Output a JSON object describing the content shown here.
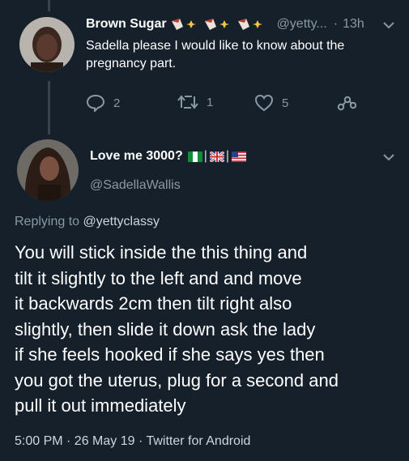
{
  "tweet1": {
    "display_name": "Brown Sugar",
    "handle": "@yetty...",
    "separator": "·",
    "time": "13h",
    "text_line1": "Sadella please I would like to know about the",
    "text_line2": "pregnancy part.",
    "replies": "2",
    "retweets": "1",
    "likes": "5"
  },
  "tweet2": {
    "display_name": "Love me 3000?",
    "handle": "@SadellaWallis",
    "replying_prefix": "Replying to ",
    "replying_handle": "@yettyclassy",
    "lines": [
      "You will stick inside the this thing and",
      "tilt it slightly to the left and and move",
      "it backwards 2cm then tilt right also",
      "slightly, then slide it down ask the lady",
      "if she feels hooked if she says yes then",
      "you got the uterus, plug for a second and",
      "pull it out immediately"
    ],
    "footer": "5:00 PM · 26 May 19 · Twitter for Android"
  },
  "colors": {
    "background": "#15202b",
    "text": "#ffffff",
    "secondary": "#8899a6",
    "thread_line": "#38444d"
  },
  "icons": [
    "reply-icon",
    "retweet-icon",
    "like-icon",
    "share-icon",
    "chevron-down-icon",
    "nigeria-flag-icon",
    "uk-flag-icon",
    "us-flag-icon",
    "emoji-sequence-icon"
  ]
}
